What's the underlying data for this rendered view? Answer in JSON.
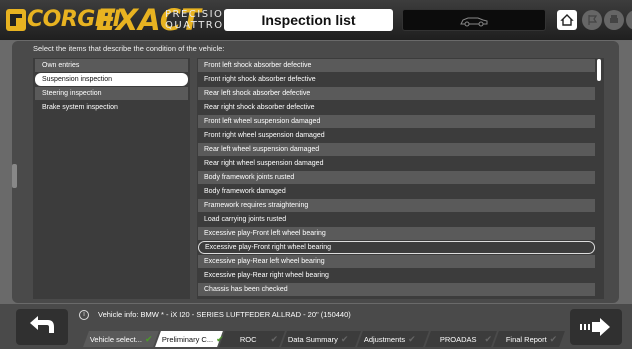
{
  "header": {
    "brand": "CORGHI",
    "product": "EXACT",
    "product_sub1": "PRECISION",
    "product_sub2": "QUATTRO",
    "title": "Inspection list",
    "icons": [
      "car-icon",
      "home-icon",
      "flag-icon",
      "print-icon",
      "help-icon"
    ]
  },
  "main": {
    "instruction": "Select the items that describe the condition of the vehicle:",
    "categories": [
      {
        "label": "Own entries"
      },
      {
        "label": "Suspension inspection"
      },
      {
        "label": "Steering inspection"
      },
      {
        "label": "Brake system inspection"
      }
    ],
    "selected_category": "Suspension inspection",
    "items": [
      {
        "label": "Front left shock absorber defective"
      },
      {
        "label": "Front right shock absorber defective"
      },
      {
        "label": "Rear left shock absorber defective"
      },
      {
        "label": "Rear right shock absorber defective"
      },
      {
        "label": "Front left wheel suspension damaged"
      },
      {
        "label": "Front right wheel suspension damaged"
      },
      {
        "label": "Rear left wheel suspension damaged"
      },
      {
        "label": "Rear right wheel suspension damaged"
      },
      {
        "label": "Body framework joints rusted"
      },
      {
        "label": "Body framework damaged"
      },
      {
        "label": "Framework requires straightening"
      },
      {
        "label": "Load carrying joints rusted"
      },
      {
        "label": "Excessive play-Front left wheel bearing"
      },
      {
        "label": "Excessive play-Front right wheel bearing"
      },
      {
        "label": "Excessive play-Rear left wheel bearing"
      },
      {
        "label": "Excessive play-Rear right wheel bearing"
      },
      {
        "label": "Chassis has been checked"
      }
    ],
    "selected_item": "Excessive play-Front right wheel bearing"
  },
  "footer": {
    "info_icon": "info-icon",
    "vehicle_info": "Vehicle info: BMW * - iX I20 - SERIES LUFTFEDER ALLRAD - 20\" (150440)",
    "tabs": [
      {
        "label": "Vehicle select...",
        "state": "done"
      },
      {
        "label": "Preliminary C...",
        "state": "active"
      },
      {
        "label": "ROC",
        "state": "pending"
      },
      {
        "label": "Data Summary",
        "state": "pending"
      },
      {
        "label": "Adjustments",
        "state": "pending"
      },
      {
        "label": "PROADAS",
        "state": "pending"
      },
      {
        "label": "Final Report",
        "state": "pending"
      }
    ],
    "back_icon": "back-arrow-icon",
    "next_icon": "next-arrow-icon"
  },
  "colors": {
    "brand": "#e8b321",
    "check_done": "#4c9a2a"
  }
}
